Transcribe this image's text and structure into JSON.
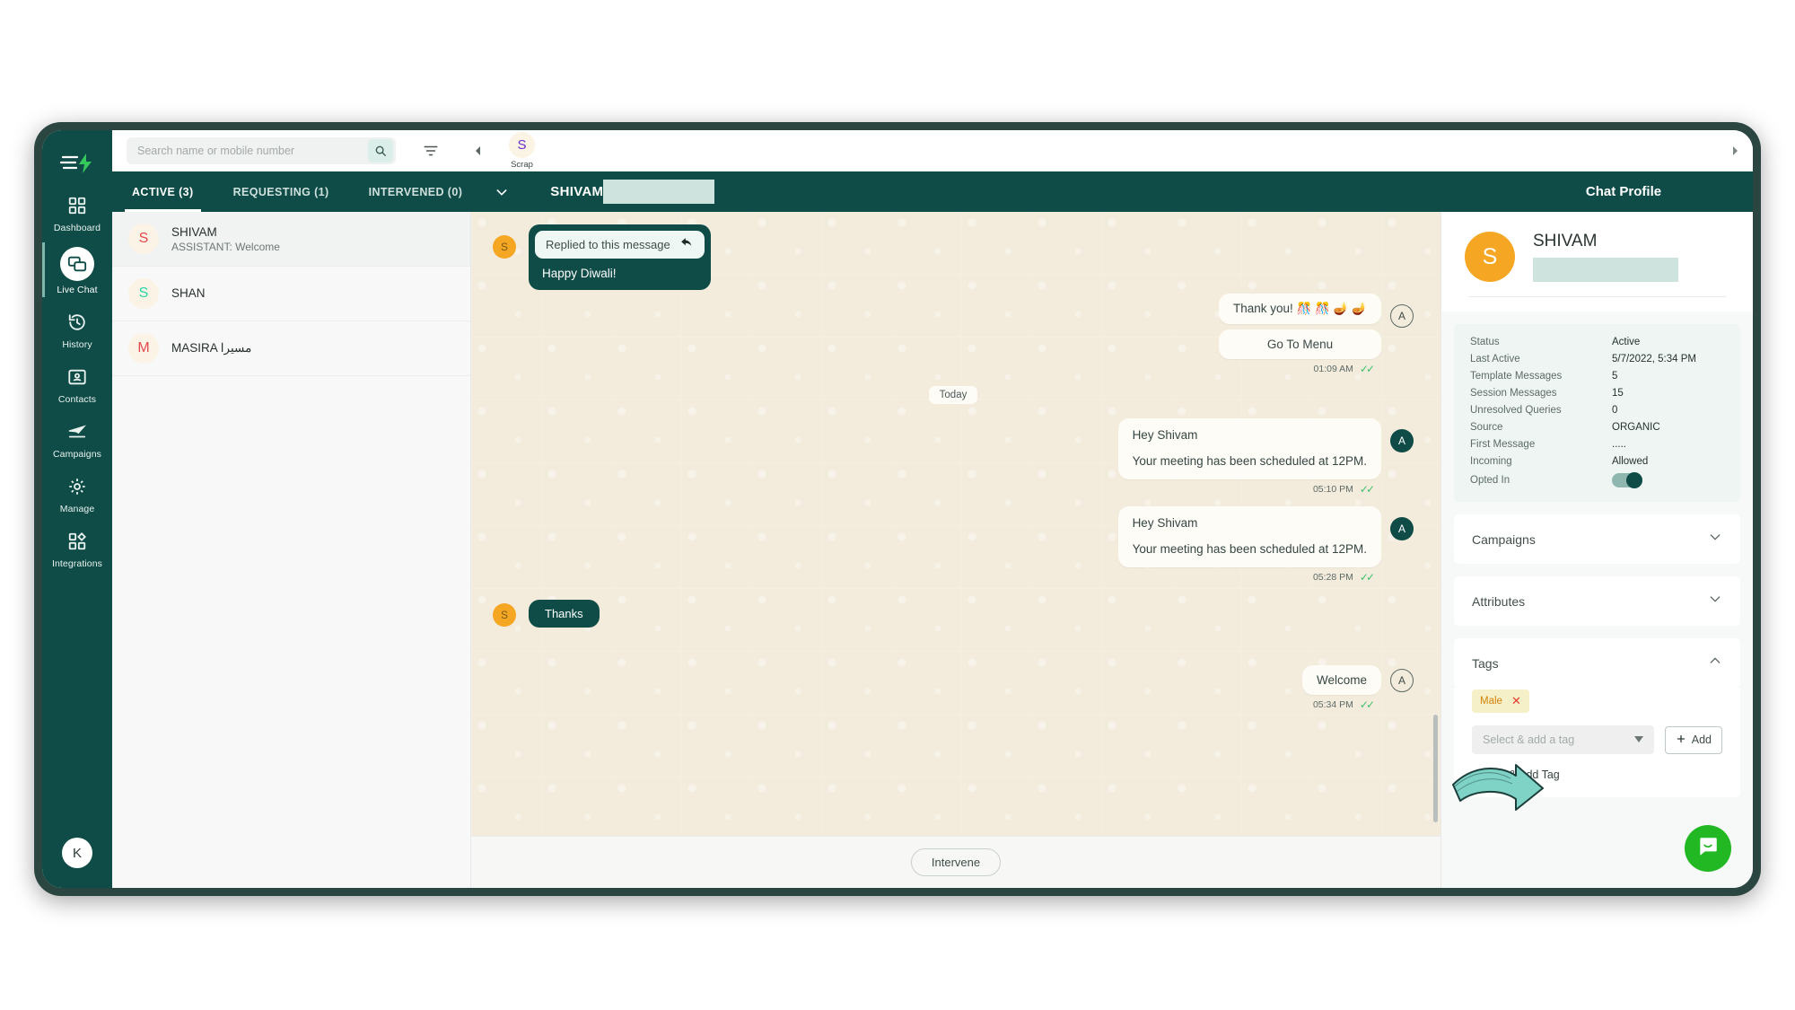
{
  "topbar": {
    "search_placeholder": "Search name or mobile number",
    "search_value": "",
    "scrap_initial": "S",
    "scrap_label": "Scrap"
  },
  "rail": {
    "items": [
      {
        "label": "Dashboard",
        "icon": "grid-icon",
        "active": false
      },
      {
        "label": "Live Chat",
        "icon": "chat-icon",
        "active": true
      },
      {
        "label": "History",
        "icon": "history-icon",
        "active": false
      },
      {
        "label": "Contacts",
        "icon": "contacts-icon",
        "active": false
      },
      {
        "label": "Campaigns",
        "icon": "campaign-icon",
        "active": false
      },
      {
        "label": "Manage",
        "icon": "gear-icon",
        "active": false
      },
      {
        "label": "Integrations",
        "icon": "integrations-icon",
        "active": false
      }
    ],
    "user_initial": "K"
  },
  "tabs": [
    {
      "label": "ACTIVE (3)",
      "active": true
    },
    {
      "label": "REQUESTING (1)",
      "active": false
    },
    {
      "label": "INTERVENED (0)",
      "active": false
    }
  ],
  "conversation_header": {
    "title": "SHIVAM",
    "redacted": true
  },
  "profile_header": {
    "title": "Chat Profile"
  },
  "conversations": [
    {
      "initial": "S",
      "initial_color": "#e5484d",
      "name": "SHIVAM",
      "preview": "ASSISTANT: Welcome",
      "selected": true
    },
    {
      "initial": "S",
      "initial_color": "#2ad4a6",
      "name": "SHAN",
      "preview": "",
      "selected": false
    },
    {
      "initial": "M",
      "initial_color": "#e5484d",
      "name": "MASIRA مسيرا",
      "preview": "",
      "selected": false
    }
  ],
  "messages": [
    {
      "type": "incoming-reply",
      "avatar": "S",
      "quote": "Replied to this message",
      "quote_icon": "reply-arrow-icon",
      "text": "Happy Diwali!"
    },
    {
      "type": "outgoing",
      "avatar": "A",
      "avatar_style": "outline",
      "text": "Thank you! 🎊 🎊 🪔 🪔",
      "button": "Go To Menu",
      "time": "01:09 AM",
      "ticks": "✓✓"
    },
    {
      "type": "day-divider",
      "label": "Today"
    },
    {
      "type": "outgoing",
      "avatar": "A",
      "avatar_style": "solid",
      "line1": "Hey Shivam",
      "line2": "Your meeting has been scheduled at 12PM.",
      "time": "05:10 PM",
      "ticks": "✓✓"
    },
    {
      "type": "outgoing",
      "avatar": "A",
      "avatar_style": "solid",
      "line1": "Hey Shivam",
      "line2": "Your meeting has been scheduled at 12PM.",
      "time": "05:28 PM",
      "ticks": "✓✓",
      "annotated": true
    },
    {
      "type": "incoming-plain",
      "avatar": "S",
      "text": "Thanks"
    },
    {
      "type": "outgoing",
      "avatar": "A",
      "avatar_style": "outline",
      "text": "Welcome",
      "time": "05:34 PM",
      "ticks": "✓✓"
    }
  ],
  "chat_footer": {
    "intervene_label": "Intervene"
  },
  "profile": {
    "avatar_initial": "S",
    "name": "SHIVAM",
    "phone_redacted": true,
    "stats": [
      {
        "key": "Status",
        "value": "Active"
      },
      {
        "key": "Last Active",
        "value": "5/7/2022, 5:34 PM"
      },
      {
        "key": "Template Messages",
        "value": "5"
      },
      {
        "key": "Session Messages",
        "value": "15"
      },
      {
        "key": "Unresolved Queries",
        "value": "0"
      },
      {
        "key": "Source",
        "value": "ORGANIC"
      },
      {
        "key": "First Message",
        "value": "....."
      },
      {
        "key": "Incoming",
        "value": "Allowed"
      },
      {
        "key": "Opted In",
        "value": "",
        "toggle": true,
        "toggle_on": true
      }
    ],
    "sections": [
      {
        "title": "Campaigns",
        "expanded": false
      },
      {
        "title": "Attributes",
        "expanded": false
      },
      {
        "title": "Tags",
        "expanded": true
      }
    ],
    "tags": [
      {
        "label": "Male"
      }
    ],
    "tag_select_placeholder": "Select & add a tag",
    "add_button_label": "Add",
    "create_add_tag_label": "Create & Add Tag"
  },
  "colors": {
    "brand_teal": "#0f4c47",
    "chat_bg": "#f3ecdc",
    "accent_orange": "#f5a623",
    "intercom_green": "#22b824",
    "annotation_arrow": "#79cfc4"
  }
}
